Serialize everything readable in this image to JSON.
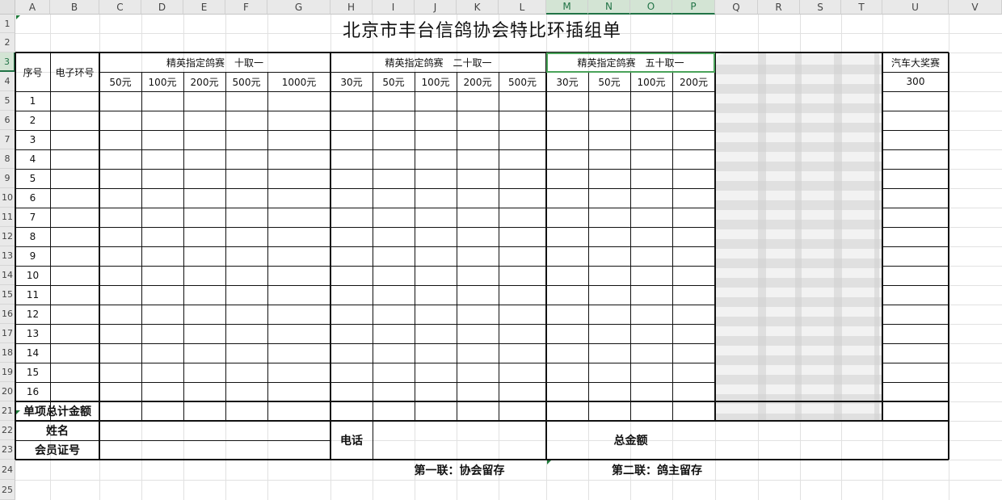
{
  "columns": [
    "A",
    "B",
    "C",
    "D",
    "E",
    "F",
    "G",
    "H",
    "I",
    "J",
    "K",
    "L",
    "M",
    "N",
    "O",
    "P",
    "Q",
    "R",
    "S",
    "T",
    "U",
    "V"
  ],
  "rows": [
    "1",
    "2",
    "3",
    "4",
    "5",
    "6",
    "7",
    "8",
    "9",
    "10",
    "11",
    "12",
    "13",
    "14",
    "15",
    "16",
    "17",
    "18",
    "19",
    "20",
    "21",
    "22",
    "23",
    "24",
    "25"
  ],
  "title": "北京市丰台信鸽协会特比环插组单",
  "headers": {
    "seq": "序号",
    "ring": "电子环号",
    "group1": "精英指定鸽赛　十取一",
    "group2": "精英指定鸽赛　二十取一",
    "group3": "精英指定鸽赛　五十取一",
    "car": "汽车大奖赛"
  },
  "amounts1": [
    "50元",
    "100元",
    "200元",
    "500元",
    "1000元"
  ],
  "amounts2": [
    "30元",
    "50元",
    "100元",
    "200元",
    "500元"
  ],
  "amounts3": [
    "30元",
    "50元",
    "100元",
    "200元"
  ],
  "car_amount": "300",
  "seq_numbers": [
    "1",
    "2",
    "3",
    "4",
    "5",
    "6",
    "7",
    "8",
    "9",
    "10",
    "11",
    "12",
    "13",
    "14",
    "15",
    "16"
  ],
  "footer": {
    "subtotal": "单项总计金额",
    "name": "姓名",
    "member_id": "会员证号",
    "phone": "电话",
    "total": "总金额",
    "copy1": "第一联：协会留存",
    "copy2": "第二联：鸽主留存"
  },
  "colors": {
    "accent": "#217346",
    "selection": "#4aa35a"
  }
}
